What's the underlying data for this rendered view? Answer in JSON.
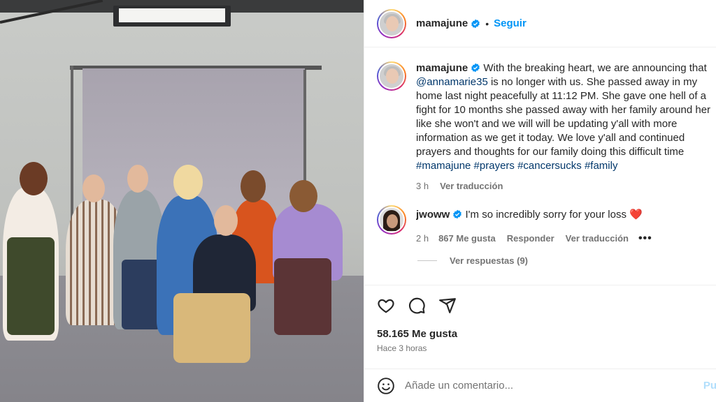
{
  "post": {
    "author": "mamajune",
    "follow_label": "Seguir",
    "dot": "•"
  },
  "caption": {
    "author": "mamajune",
    "line1": "With the breaking heart, we are announcing that",
    "mention": "@annamarie35",
    "line2_rest": " is no longer with us. She passed away in my",
    "line3": "home last night peacefully at 11:12 PM. She gave one hell of a",
    "line4": "fight for 10 months she passed away with her family around her",
    "line5": "like she won't and we will will be updating y'all with more",
    "line6": "information as we get it today. We love y'all and continued",
    "line7": "prayers and thoughts for our family doing this difficult time",
    "hashtags": "#mamajune #prayers #cancersucks #family",
    "time": "3 h",
    "translate": "Ver traducción"
  },
  "reply": {
    "author": "jwoww",
    "text": "I'm so incredibly sorry for your loss",
    "heart": "❤️",
    "time": "2 h",
    "likes": "867 Me gusta",
    "respond": "Responder",
    "translate": "Ver traducción",
    "more": "•••",
    "view_replies": "Ver respuestas (9)"
  },
  "stats": {
    "likes": "58.165 Me gusta",
    "ago": "Hace 3 horas"
  },
  "composer": {
    "placeholder": "Añade un comentario...",
    "publish": "Pu"
  },
  "colors": {
    "accent": "#0095f6",
    "verified": "#0095f6",
    "muted": "#737373"
  },
  "icons": [
    "verified-badge-icon",
    "heart-icon",
    "comment-icon",
    "share-icon",
    "emoji-icon"
  ]
}
